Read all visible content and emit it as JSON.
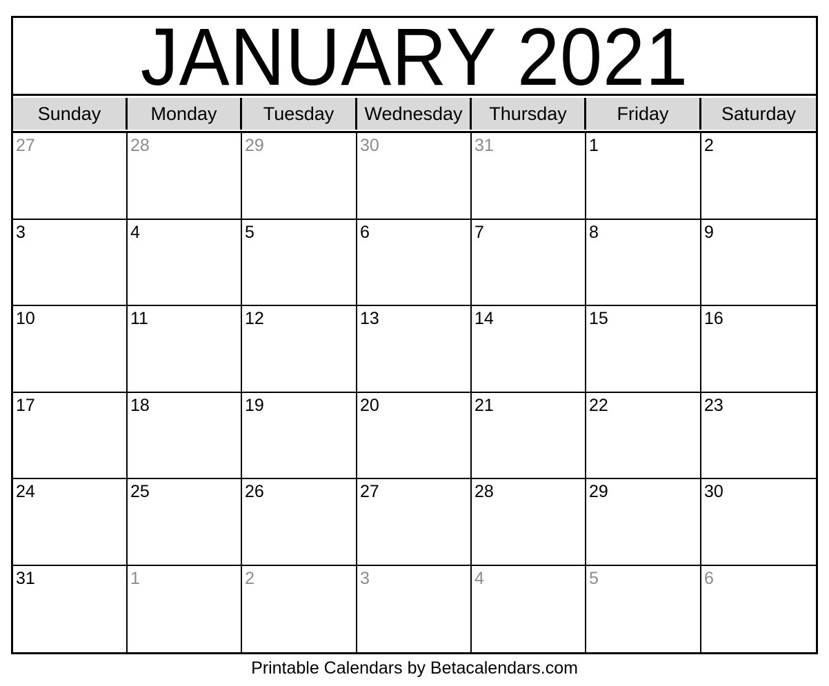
{
  "calendar": {
    "title": "JANUARY 2021",
    "weekdays": [
      "Sunday",
      "Monday",
      "Tuesday",
      "Wednesday",
      "Thursday",
      "Friday",
      "Saturday"
    ],
    "weeks": [
      [
        {
          "day": "27",
          "in_month": false
        },
        {
          "day": "28",
          "in_month": false
        },
        {
          "day": "29",
          "in_month": false
        },
        {
          "day": "30",
          "in_month": false
        },
        {
          "day": "31",
          "in_month": false
        },
        {
          "day": "1",
          "in_month": true
        },
        {
          "day": "2",
          "in_month": true
        }
      ],
      [
        {
          "day": "3",
          "in_month": true
        },
        {
          "day": "4",
          "in_month": true
        },
        {
          "day": "5",
          "in_month": true
        },
        {
          "day": "6",
          "in_month": true
        },
        {
          "day": "7",
          "in_month": true
        },
        {
          "day": "8",
          "in_month": true
        },
        {
          "day": "9",
          "in_month": true
        }
      ],
      [
        {
          "day": "10",
          "in_month": true
        },
        {
          "day": "11",
          "in_month": true
        },
        {
          "day": "12",
          "in_month": true
        },
        {
          "day": "13",
          "in_month": true
        },
        {
          "day": "14",
          "in_month": true
        },
        {
          "day": "15",
          "in_month": true
        },
        {
          "day": "16",
          "in_month": true
        }
      ],
      [
        {
          "day": "17",
          "in_month": true
        },
        {
          "day": "18",
          "in_month": true
        },
        {
          "day": "19",
          "in_month": true
        },
        {
          "day": "20",
          "in_month": true
        },
        {
          "day": "21",
          "in_month": true
        },
        {
          "day": "22",
          "in_month": true
        },
        {
          "day": "23",
          "in_month": true
        }
      ],
      [
        {
          "day": "24",
          "in_month": true
        },
        {
          "day": "25",
          "in_month": true
        },
        {
          "day": "26",
          "in_month": true
        },
        {
          "day": "27",
          "in_month": true
        },
        {
          "day": "28",
          "in_month": true
        },
        {
          "day": "29",
          "in_month": true
        },
        {
          "day": "30",
          "in_month": true
        }
      ],
      [
        {
          "day": "31",
          "in_month": true
        },
        {
          "day": "1",
          "in_month": false
        },
        {
          "day": "2",
          "in_month": false
        },
        {
          "day": "3",
          "in_month": false
        },
        {
          "day": "4",
          "in_month": false
        },
        {
          "day": "5",
          "in_month": false
        },
        {
          "day": "6",
          "in_month": false
        }
      ]
    ]
  },
  "colors": {
    "header_bg": "#d9d9d9",
    "other_month_text": "#8c8c8c",
    "border": "#000000"
  },
  "footer": {
    "text": "Printable Calendars by Betacalendars.com"
  }
}
